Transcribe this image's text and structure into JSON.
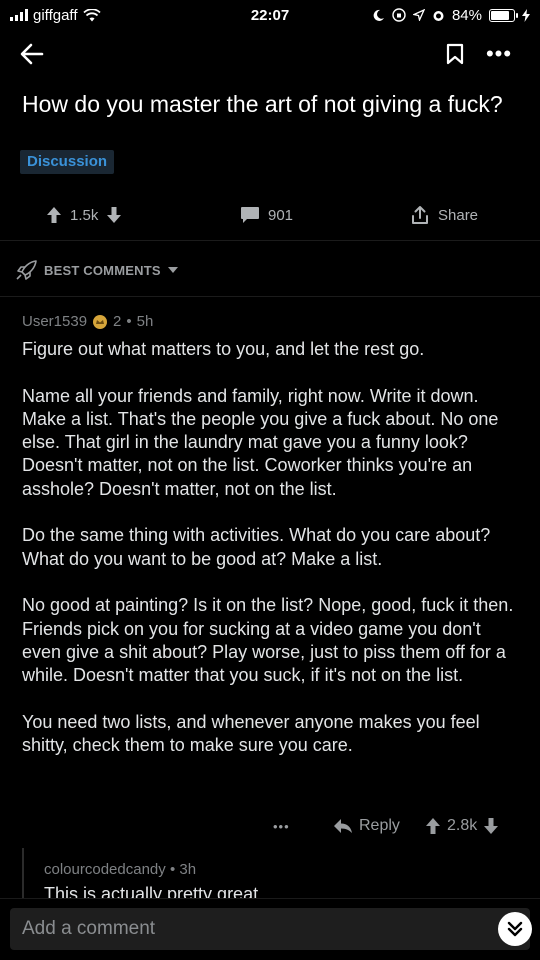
{
  "status_bar": {
    "carrier": "giffgaff",
    "time": "22:07",
    "battery_percent": "84%",
    "battery_level": 0.84
  },
  "nav": {
    "back_icon": "arrow-left-icon",
    "bookmark_icon": "bookmark-icon",
    "more_label": "•••"
  },
  "post": {
    "title": "How do you master the art of not giving a fuck?",
    "flair": "Discussion",
    "upvotes": "1.5k",
    "comments": "901",
    "share_label": "Share"
  },
  "sort": {
    "label": "BEST COMMENTS"
  },
  "comment": {
    "author": "User1539",
    "award_count": "2",
    "separator": "•",
    "age": "5h",
    "paragraphs": [
      "Figure out what matters to you, and let the rest go.",
      "Name all your friends and family, right now. Write it down. Make a list. That's the people you give a fuck about. No one else. That girl in the laundry mat gave you a funny look? Doesn't matter, not on the list. Coworker thinks you're an asshole? Doesn't matter, not on the list.",
      "Do the same thing with activities. What do you care about? What do you want to be good at? Make a list.",
      "No good at painting? Is it on the list? Nope, good, fuck it then. Friends pick on you for sucking at a video game you don't even give a shit about? Play worse, just to piss them off for a while. Doesn't matter that you suck, if it's not on the list.",
      "You need two lists, and whenever anyone makes you feel shitty, check them to make sure you care."
    ],
    "more_label": "•••",
    "reply_label": "Reply",
    "score": "2.8k"
  },
  "reply": {
    "author": "colourcodedcandy",
    "separator": "•",
    "age": "3h",
    "text": "This is actually pretty great"
  },
  "composer": {
    "placeholder": "Add a comment"
  }
}
